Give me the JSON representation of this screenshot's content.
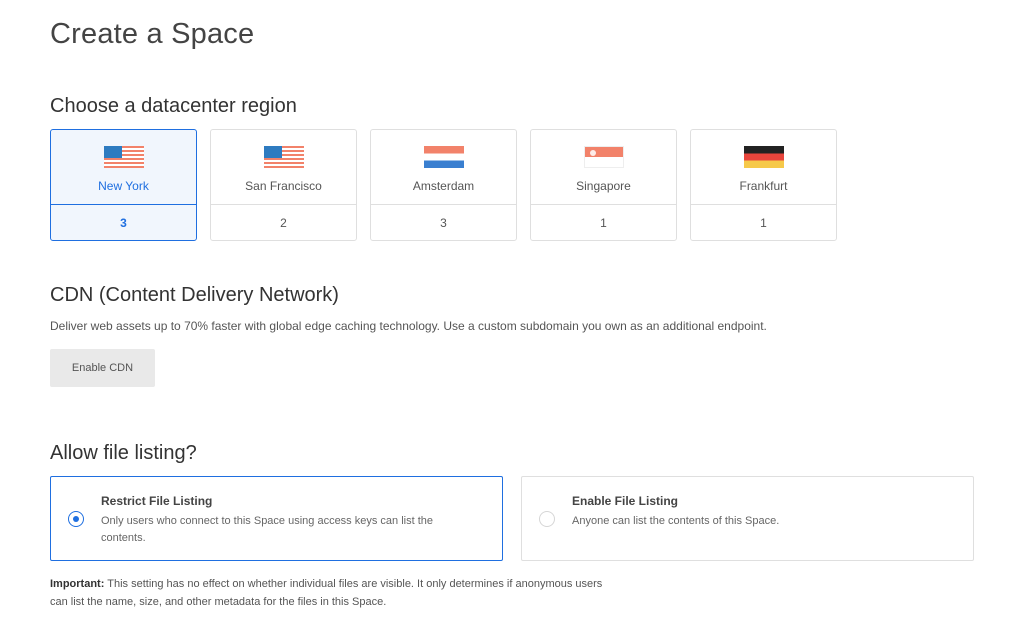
{
  "page": {
    "title": "Create a Space"
  },
  "region_section": {
    "title": "Choose a datacenter region",
    "regions": [
      {
        "name": "New York",
        "count": "3",
        "flag": "us-flag-icon",
        "selected": true
      },
      {
        "name": "San Francisco",
        "count": "2",
        "flag": "us-flag-icon",
        "selected": false
      },
      {
        "name": "Amsterdam",
        "count": "3",
        "flag": "netherlands-flag-icon",
        "selected": false
      },
      {
        "name": "Singapore",
        "count": "1",
        "flag": "singapore-flag-icon",
        "selected": false
      },
      {
        "name": "Frankfurt",
        "count": "1",
        "flag": "germany-flag-icon",
        "selected": false
      }
    ]
  },
  "cdn": {
    "title": "CDN (Content Delivery Network)",
    "description": "Deliver web assets up to 70% faster with global edge caching technology. Use a custom subdomain you own as an additional endpoint.",
    "button_label": "Enable CDN"
  },
  "file_listing": {
    "title": "Allow file listing?",
    "options": [
      {
        "title": "Restrict File Listing",
        "description": "Only users who connect to this Space using access keys can list the contents.",
        "selected": true
      },
      {
        "title": "Enable File Listing",
        "description": "Anyone can list the contents of this Space.",
        "selected": false
      }
    ],
    "important_label": "Important:",
    "important_text": " This setting has no effect on whether individual files are visible. It only determines if anonymous users can list the name, size, and other metadata for the files in this Space."
  },
  "colors": {
    "accent": "#1f6fe0",
    "selected_bg": "#f1f6fd",
    "border": "#dfdfdf"
  }
}
